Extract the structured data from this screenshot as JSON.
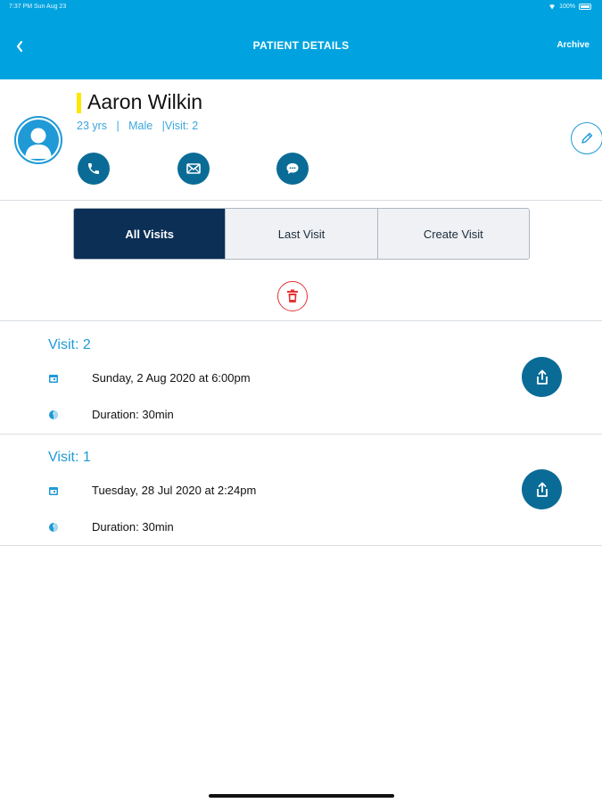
{
  "status_bar": {
    "time": "7:37 PM  Sun Aug 23",
    "battery": "100%"
  },
  "nav": {
    "title": "PATIENT DETAILS",
    "archive_label": "Archive",
    "back_icon": "chevron-left-icon"
  },
  "patient": {
    "name": "Aaron Wilkin",
    "age": "23 yrs",
    "gender": "Male",
    "visit_count": "Visit: 2",
    "separator": "   |   ",
    "separator2": "   |"
  },
  "tabs": [
    {
      "label": "All Visits",
      "active": true
    },
    {
      "label": "Last Visit",
      "active": false
    },
    {
      "label": "Create Visit",
      "active": false
    }
  ],
  "visits": [
    {
      "title": "Visit: 2",
      "datetime": "Sunday, 2 Aug 2020  at 6:00pm",
      "duration": "Duration: 30min"
    },
    {
      "title": "Visit: 1",
      "datetime": "Tuesday, 28 Jul 2020  at 2:24pm",
      "duration": "Duration: 30min"
    }
  ],
  "colors": {
    "header": "#00a3e0",
    "accent": "#1f9ad6",
    "dark_button": "#0a6c96",
    "active_tab": "#0b2f55",
    "delete": "#e63131"
  }
}
